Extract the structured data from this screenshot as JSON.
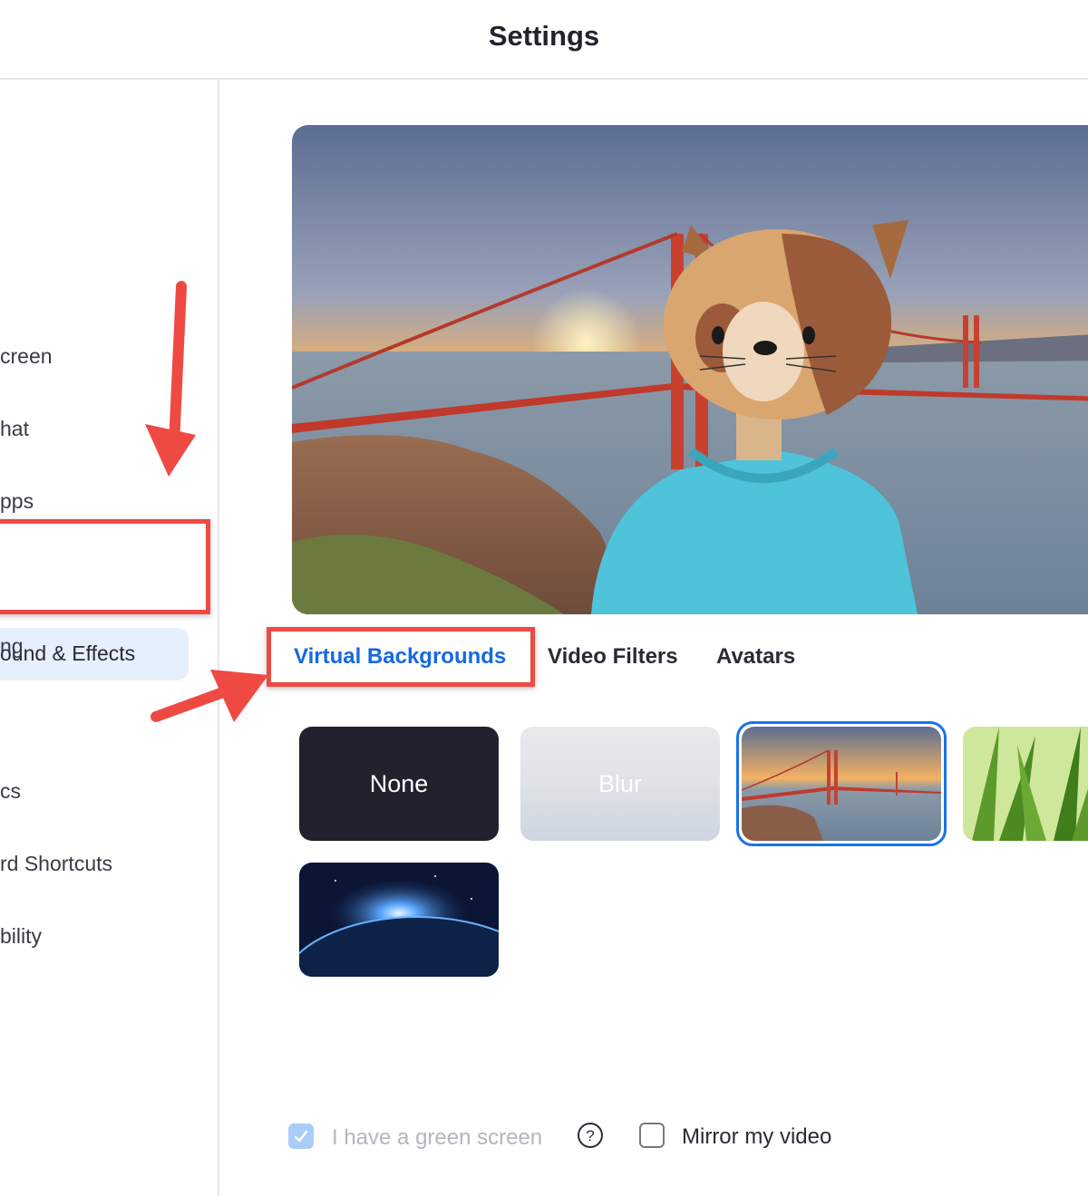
{
  "window": {
    "title": "Settings"
  },
  "sidebar": {
    "items": [
      {
        "label": "creen"
      },
      {
        "label": "hat"
      },
      {
        "label": "pps"
      },
      {
        "label": "ound & Effects"
      },
      {
        "label": "ng"
      },
      {
        "label": "cs"
      },
      {
        "label": "rd Shortcuts"
      },
      {
        "label": "bility"
      }
    ]
  },
  "preview": {
    "image": "golden-gate-bridge-with-cat-avatar"
  },
  "tabs": [
    {
      "label": "Virtual Backgrounds"
    },
    {
      "label": "Video Filters"
    },
    {
      "label": "Avatars"
    }
  ],
  "backgrounds": [
    {
      "label": "None"
    },
    {
      "label": "Blur"
    },
    {
      "image": "golden-gate-bridge",
      "selected": true
    },
    {
      "image": "grass"
    },
    {
      "image": "earth-from-space"
    }
  ],
  "options": {
    "green_screen": {
      "label": "I have a green screen",
      "checked": true,
      "disabled": true
    },
    "mirror": {
      "label": "Mirror my video",
      "checked": false
    }
  },
  "colors": {
    "accent": "#1669e0",
    "highlight": "#ee4a43"
  }
}
